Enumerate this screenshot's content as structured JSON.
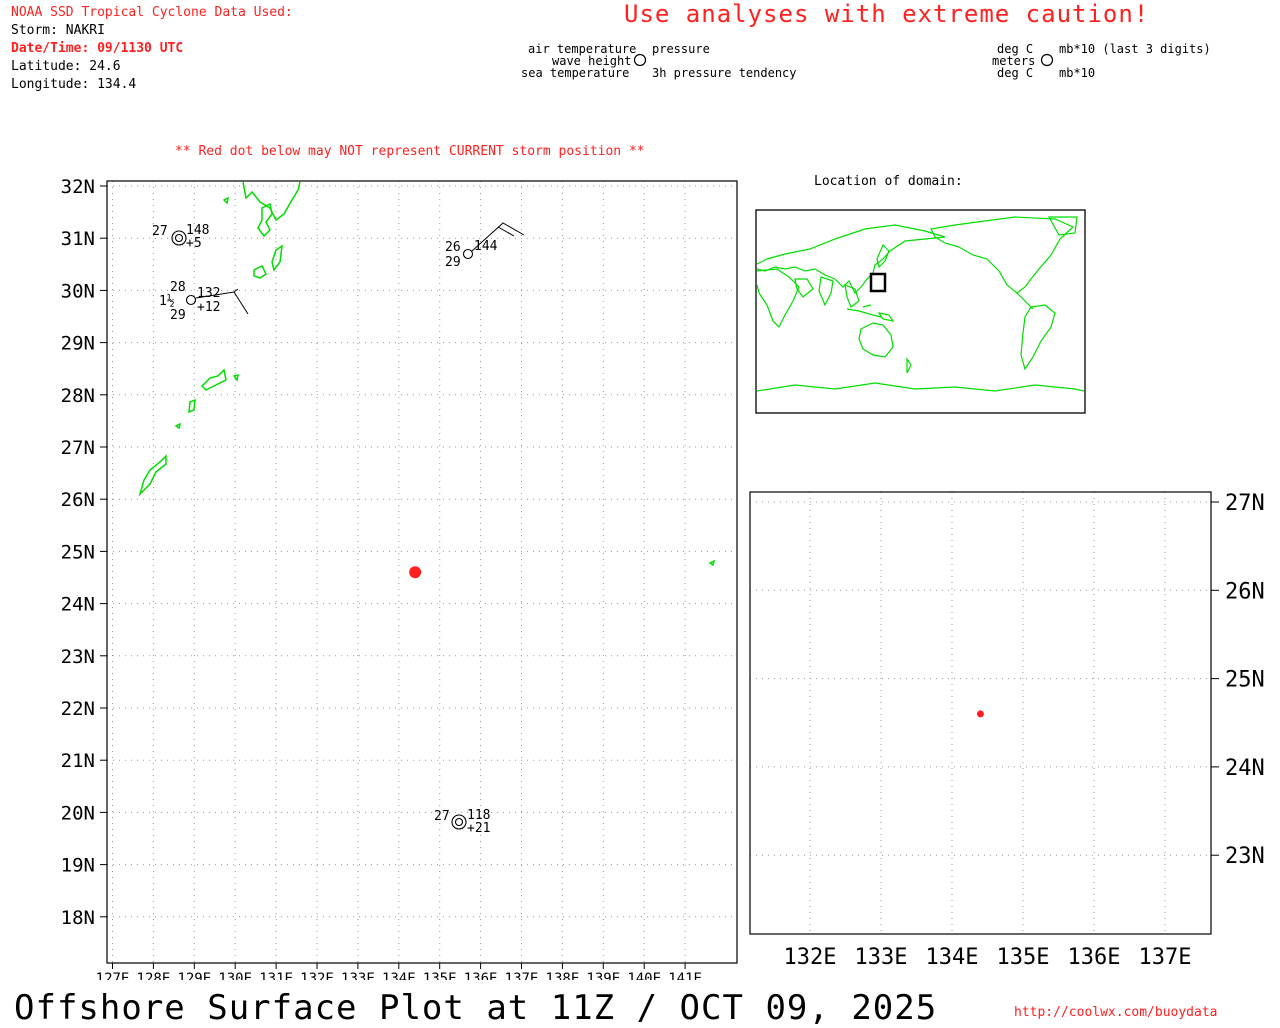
{
  "header": {
    "source_title": "NOAA SSD Tropical Cyclone Data Used:",
    "storm": "Storm: NAKRI",
    "datetime": "Date/Time: 09/1130 UTC",
    "latitude": "Latitude: 24.6",
    "longitude": "Longitude: 134.4",
    "caution": "Use analyses with extreme caution!"
  },
  "legend": {
    "left": {
      "air_temperature": "air temperature",
      "wave_height": "wave height",
      "sea_temperature": "sea temperature",
      "pressure": "pressure",
      "pressure_tendency": "3h pressure tendency"
    },
    "right": {
      "deg_c_top": "deg C",
      "meters": "meters",
      "deg_c_bottom": "deg C",
      "mb_last3": "mb*10 (last 3 digits)",
      "mb": "mb*10"
    }
  },
  "notice": "** Red dot below may NOT represent CURRENT storm position **",
  "locator_title": "Location of domain:",
  "main_map": {
    "lat_labels": [
      "32N",
      "31N",
      "30N",
      "29N",
      "28N",
      "27N",
      "26N",
      "25N",
      "24N",
      "23N",
      "22N",
      "21N",
      "20N",
      "19N",
      "18N"
    ],
    "lon_labels": [
      "127E",
      "128E",
      "129E",
      "130E",
      "131E",
      "132E",
      "133E",
      "134E",
      "135E",
      "136E",
      "137E",
      "138E",
      "139E",
      "140E",
      "141E"
    ],
    "stations": [
      {
        "id": "stn-31n",
        "air": "27",
        "pressure": "148",
        "tendency": "+5"
      },
      {
        "id": "stn-30n",
        "air": "28",
        "wave": "1½",
        "sea": "29",
        "pressure": "132",
        "tendency": "+12"
      },
      {
        "id": "stn-31n-east",
        "air": "26",
        "sea": "29",
        "pressure": "144"
      },
      {
        "id": "stn-20n",
        "air": "27",
        "pressure": "118",
        "tendency": "+21"
      }
    ],
    "storm_marker": {
      "lat": 24.6,
      "lon": 134.4,
      "color": "#ff2020"
    }
  },
  "zoom_map": {
    "lat_labels": [
      "27N",
      "26N",
      "25N",
      "24N",
      "23N"
    ],
    "lon_labels": [
      "132E",
      "133E",
      "134E",
      "135E",
      "136E",
      "137E"
    ]
  },
  "footer": {
    "title": "Offshore Surface Plot at 11Z / OCT 09, 2025",
    "url": "http://coolwx.com/buoydata"
  },
  "colors": {
    "coast": "#00dd00",
    "storm": "#ff2020",
    "grid": "#9a9a9a"
  }
}
